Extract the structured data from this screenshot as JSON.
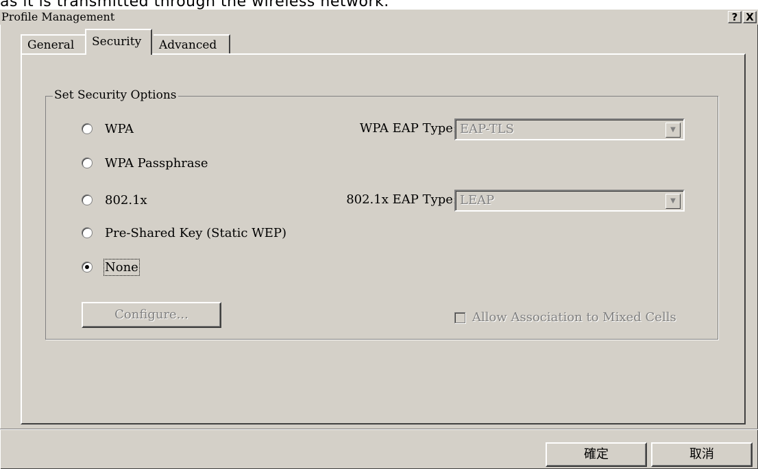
{
  "caption": "as it is transmitted through the wireless network.",
  "window": {
    "title": "Profile Management",
    "help_button": "?",
    "close_button": "X"
  },
  "tabs": [
    {
      "label": "General",
      "selected": false
    },
    {
      "label": "Security",
      "selected": true
    },
    {
      "label": "Advanced",
      "selected": false
    }
  ],
  "security": {
    "group_label": "Set Security Options",
    "options": [
      {
        "label": "WPA",
        "selected": false
      },
      {
        "label": "WPA Passphrase",
        "selected": false
      },
      {
        "label": "802.1x",
        "selected": false
      },
      {
        "label": "Pre-Shared Key (Static WEP)",
        "selected": false
      },
      {
        "label": "None",
        "selected": true
      }
    ],
    "wpa_eap_type_label": "WPA EAP Type:",
    "wpa_eap_type_value": "EAP-TLS",
    "dot1x_eap_type_label": "802.1x EAP Type:",
    "dot1x_eap_type_value": "LEAP",
    "configure_label": "Configure...",
    "mixed_cells_label": "Allow Association to Mixed Cells",
    "mixed_cells_checked": false
  },
  "buttons": {
    "ok_label": "確定",
    "cancel_label": "取消"
  },
  "colors": {
    "face": "#d4d0c8",
    "disabled_text": "#808080"
  }
}
